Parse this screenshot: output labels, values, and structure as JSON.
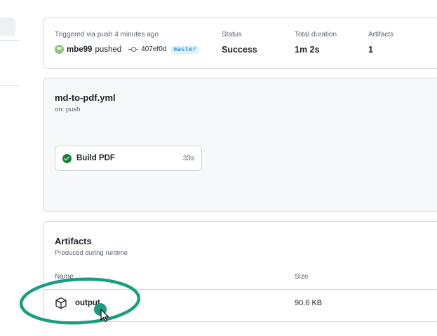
{
  "summary": {
    "trigger_text": "Triggered via push 4 minutes ago",
    "actor": "mbe99",
    "action": "pushed",
    "commit_sha": "407ef0d",
    "branch": "master",
    "status_label": "Status",
    "status_value": "Success",
    "duration_label": "Total duration",
    "duration_value": "1m 2s",
    "artifacts_label": "Artifacts",
    "artifacts_value": "1"
  },
  "workflow": {
    "file_name": "md-to-pdf.yml",
    "trigger": "on: push",
    "job": {
      "name": "Build PDF",
      "duration": "33s",
      "status": "success"
    }
  },
  "artifacts": {
    "title": "Artifacts",
    "subtitle": "Produced during runtime",
    "columns": {
      "name": "Name",
      "size": "Size"
    },
    "items": [
      {
        "name": "output",
        "size": "90.6 KB"
      }
    ]
  },
  "colors": {
    "success": "#1a7f37",
    "annotation": "#1a9e7f",
    "branch_bg": "#ddf4ff",
    "branch_fg": "#0969da"
  },
  "icons": [
    "check-circle-icon",
    "git-commit-icon",
    "package-icon",
    "mouse-cursor-icon",
    "avatar"
  ]
}
